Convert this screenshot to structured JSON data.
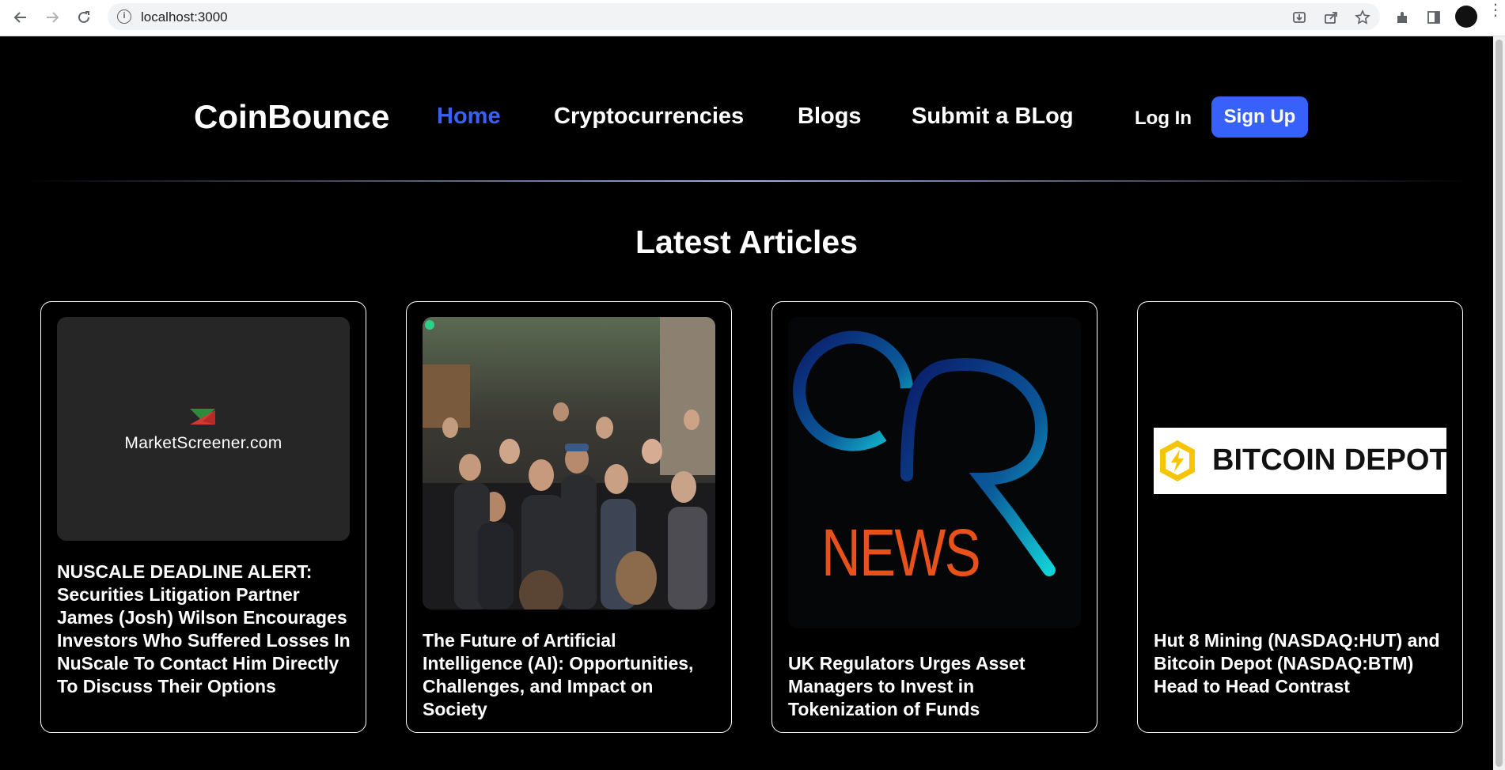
{
  "browser": {
    "url": "localhost:3000"
  },
  "nav": {
    "logo": "CoinBounce",
    "links": [
      "Home",
      "Cryptocurrencies",
      "Blogs",
      "Submit a BLog"
    ],
    "login": "Log In",
    "signup": "Sign Up",
    "active_color": "#3861fb"
  },
  "main": {
    "section_title": "Latest Articles",
    "articles": [
      {
        "image_text": "MarketScreener.com",
        "title": "NUSCALE DEADLINE ALERT: Securities Litigation Partner James (Josh) Wilson Encourages Investors Who Suffered Losses In NuScale To Contact Him Directly To Discuss Their Options"
      },
      {
        "image_text": "",
        "title": "The Future of Artificial Intelligence (AI): Opportunities, Challenges, and Impact on Society"
      },
      {
        "image_text": "NEWS",
        "title": "UK Regulators Urges Asset Managers to Invest in Tokenization of Funds"
      },
      {
        "image_text": "BITCOIN DEPOT",
        "title": "Hut 8 Mining (NASDAQ:HUT) and Bitcoin Depot (NASDAQ:BTM) Head to Head Contrast"
      }
    ]
  }
}
